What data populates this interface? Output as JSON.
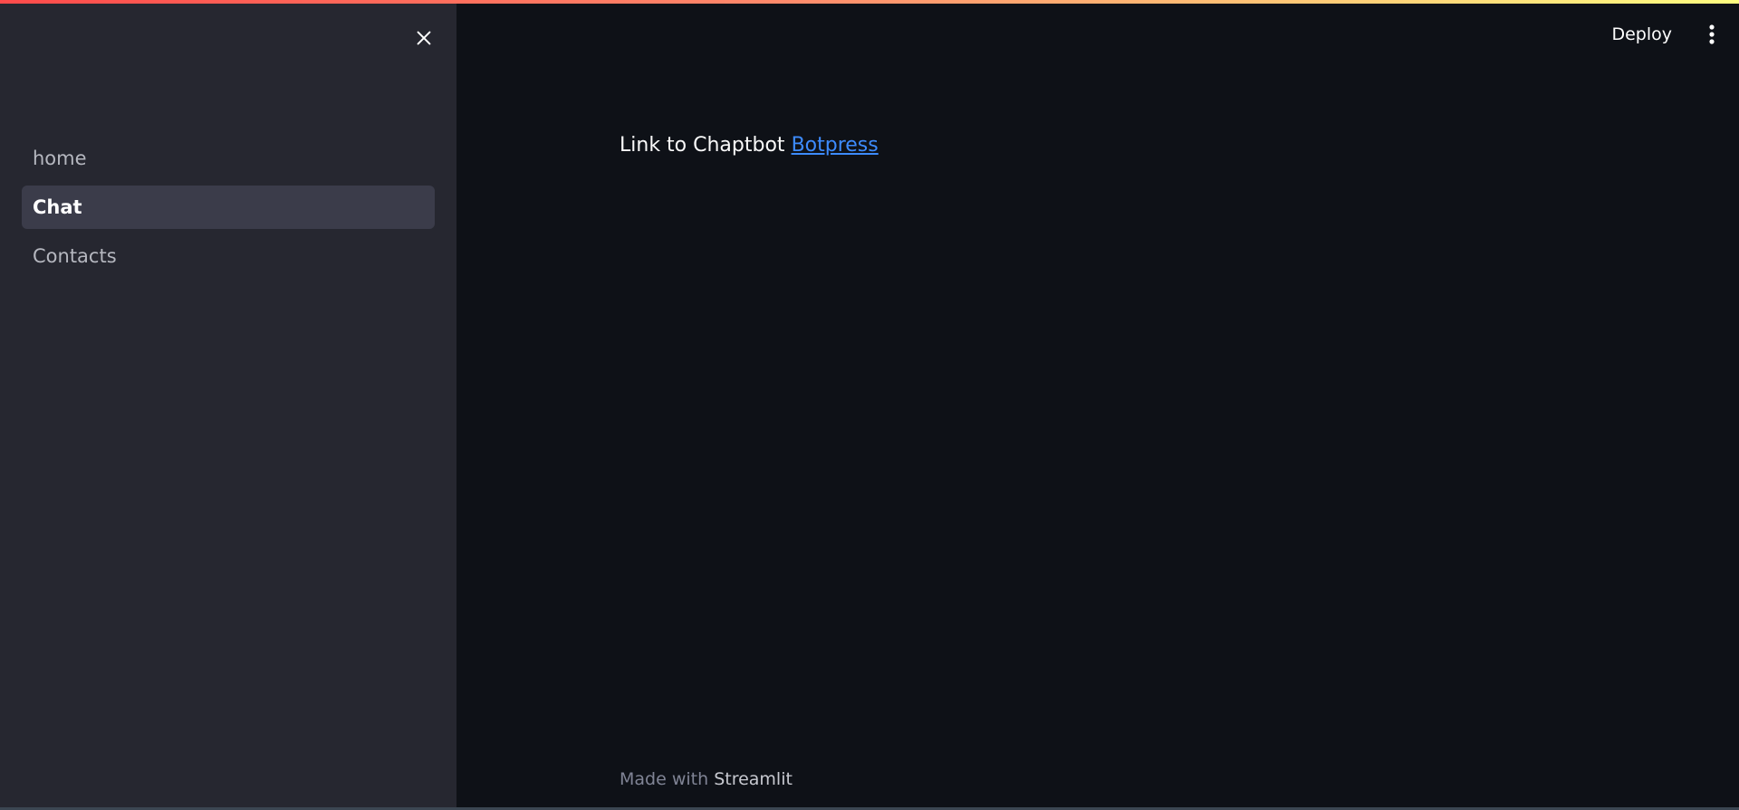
{
  "sidebar": {
    "close_icon": "close-icon",
    "items": [
      {
        "label": "home",
        "active": false
      },
      {
        "label": "Chat",
        "active": true
      },
      {
        "label": "Contacts",
        "active": false
      }
    ]
  },
  "header": {
    "deploy_label": "Deploy",
    "menu_icon": "kebab-menu-icon"
  },
  "main": {
    "text_prefix": "Link to Chaptbot",
    "link_label": "Botpress"
  },
  "footer": {
    "prefix": "Made with",
    "brand": "Streamlit"
  },
  "colors": {
    "sidebar_bg": "#262730",
    "main_bg": "#0e1117",
    "active_item_bg": "#3b3c4a",
    "link": "#3d8bfd",
    "accent_gradient_start": "#ff4b4b",
    "accent_gradient_end": "#fffd80"
  }
}
